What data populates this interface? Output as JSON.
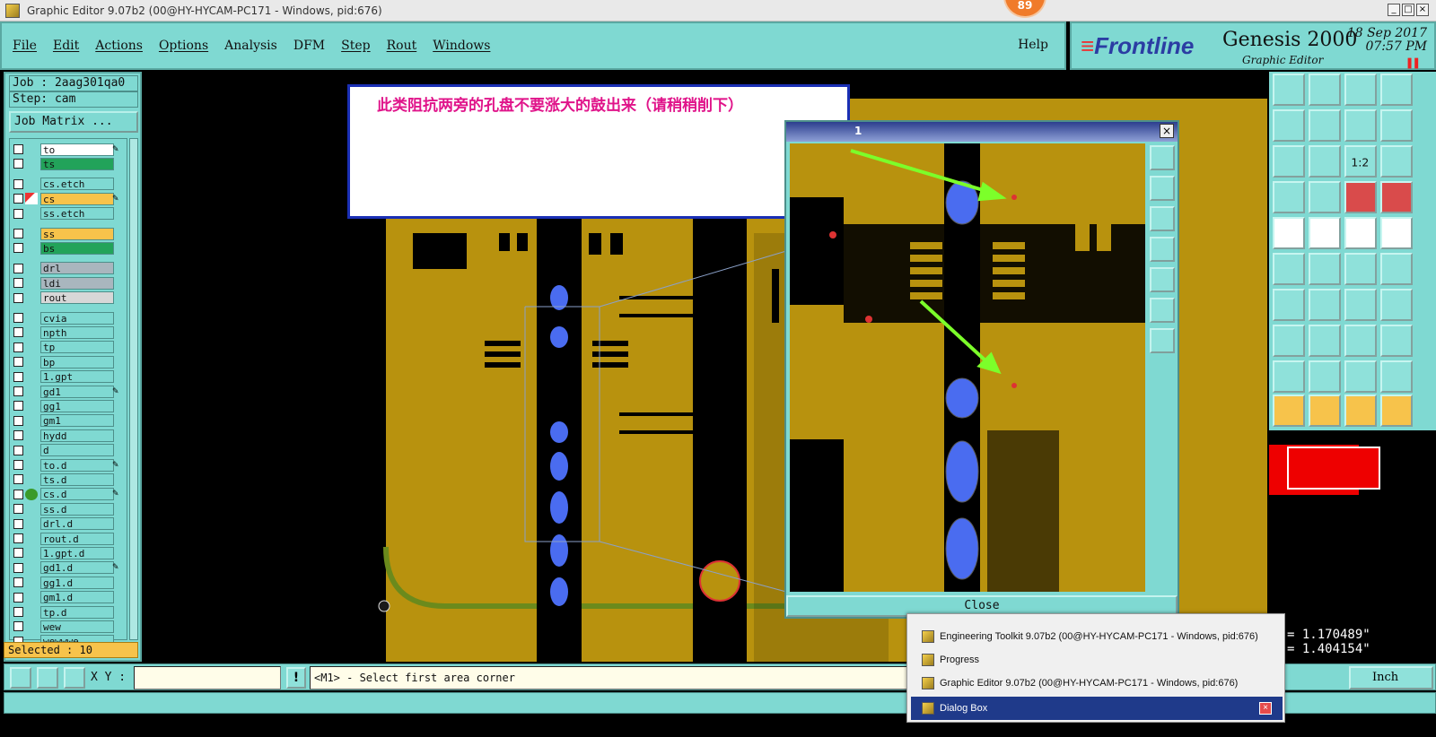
{
  "window": {
    "title": "Graphic Editor 9.07b2 (00@HY-HYCAM-PC171 - Windows, pid:676)",
    "notification_count": "89"
  },
  "menu": {
    "items": [
      "File",
      "Edit",
      "Actions",
      "Options",
      "Analysis",
      "DFM",
      "Step",
      "Rout",
      "Windows"
    ],
    "help": "Help"
  },
  "brand": {
    "logo": "Frontline",
    "product": "Genesis 2000",
    "subtitle": "Graphic Editor",
    "date": "18 Sep 2017",
    "time": "07:57 PM"
  },
  "job": {
    "job_line": "Job : 2aag301qa0",
    "step_line": "Step: cam",
    "matrix_button": "Job Matrix ..."
  },
  "layers": [
    {
      "name": "to",
      "color": "#ffffff",
      "pen": true
    },
    {
      "name": "ts",
      "color": "#22a35a",
      "pen": false
    },
    {
      "name": "cs.etch",
      "color": "#7fd9d2",
      "pen": false
    },
    {
      "name": "cs",
      "color": "#f7c34b",
      "pen": true,
      "active": true
    },
    {
      "name": "ss.etch",
      "color": "#7fd9d2",
      "pen": false
    },
    {
      "name": "ss",
      "color": "#f7c34b",
      "pen": false
    },
    {
      "name": "bs",
      "color": "#22a35a",
      "pen": false
    },
    {
      "name": "drl",
      "color": "#a9b6be",
      "pen": false
    },
    {
      "name": "ldi",
      "color": "#a9b6be",
      "pen": false
    },
    {
      "name": "rout",
      "color": "#d7d7d7",
      "pen": false
    },
    {
      "name": "cvia",
      "color": "#7fd9d2",
      "pen": false
    },
    {
      "name": "npth",
      "color": "#7fd9d2",
      "pen": false
    },
    {
      "name": "tp",
      "color": "#7fd9d2",
      "pen": false
    },
    {
      "name": "bp",
      "color": "#7fd9d2",
      "pen": false
    },
    {
      "name": "1.gpt",
      "color": "#7fd9d2",
      "pen": false
    },
    {
      "name": "gd1",
      "color": "#7fd9d2",
      "pen": true
    },
    {
      "name": "gg1",
      "color": "#7fd9d2",
      "pen": false
    },
    {
      "name": "gm1",
      "color": "#7fd9d2",
      "pen": false
    },
    {
      "name": "hydd",
      "color": "#7fd9d2",
      "pen": false
    },
    {
      "name": "d",
      "color": "#7fd9d2",
      "pen": false
    },
    {
      "name": "to.d",
      "color": "#7fd9d2",
      "pen": true
    },
    {
      "name": "ts.d",
      "color": "#7fd9d2",
      "pen": false
    },
    {
      "name": "cs.d",
      "color": "#7fd9d2",
      "pen": true,
      "dot": true
    },
    {
      "name": "ss.d",
      "color": "#7fd9d2",
      "pen": false
    },
    {
      "name": "drl.d",
      "color": "#7fd9d2",
      "pen": false
    },
    {
      "name": "rout.d",
      "color": "#7fd9d2",
      "pen": false
    },
    {
      "name": "1.gpt.d",
      "color": "#7fd9d2",
      "pen": false
    },
    {
      "name": "gd1.d",
      "color": "#7fd9d2",
      "pen": true
    },
    {
      "name": "gg1.d",
      "color": "#7fd9d2",
      "pen": false
    },
    {
      "name": "gm1.d",
      "color": "#7fd9d2",
      "pen": false
    },
    {
      "name": "tp.d",
      "color": "#7fd9d2",
      "pen": false
    },
    {
      "name": "wew",
      "color": "#7fd9d2",
      "pen": false
    },
    {
      "name": "wewwwe",
      "color": "#7fd9d2",
      "pen": false
    }
  ],
  "selected": "Selected : 10",
  "annotation": {
    "text": "此类阻抗两旁的孔盘不要涨大的鼓出来（请稍稍削下）"
  },
  "zoom_dialog": {
    "title": "1",
    "close_label": "Close"
  },
  "coords": {
    "x": "= 1.170489\"",
    "y": "= 1.404154\""
  },
  "bottom": {
    "xy_label": "X Y :",
    "xy_value": "",
    "prompt": "<M1> - Select first area corner",
    "units": "Inch"
  },
  "taskbar": {
    "items": [
      "Engineering Toolkit 9.07b2 (00@HY-HYCAM-PC171 - Windows, pid:676)",
      "Progress",
      "Graphic Editor 9.07b2 (00@HY-HYCAM-PC171 - Windows, pid:676)",
      "Dialog Box"
    ]
  },
  "colors": {
    "panel": "#7fd9d2",
    "copper": "#b8920e",
    "pad_blue": "#4a6cf0",
    "annotation_text": "#e0148a",
    "arrow": "#7cff2a"
  }
}
